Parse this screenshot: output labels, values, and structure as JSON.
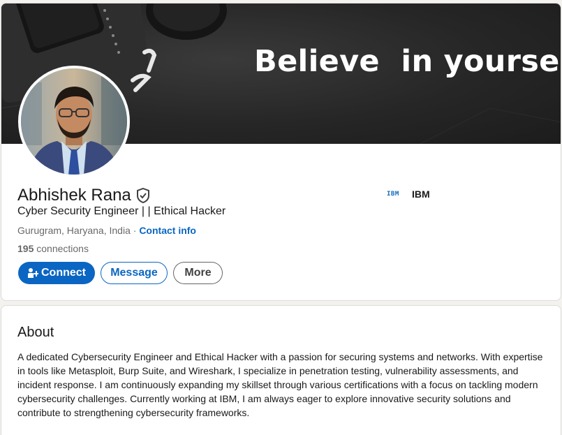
{
  "banner": {
    "text": "Believe  in yourself"
  },
  "profile": {
    "name": "Abhishek Rana",
    "headline": "Cyber Security Engineer | | Ethical Hacker",
    "location": "Gurugram, Haryana, India",
    "separator": " · ",
    "contact_label": "Contact info",
    "connections_count": "195",
    "connections_label": " connections"
  },
  "company": {
    "logo_text": "IBM",
    "name": "IBM"
  },
  "actions": {
    "connect_label": "Connect",
    "message_label": "Message",
    "more_label": "More"
  },
  "about": {
    "title": "About",
    "text": "A dedicated Cybersecurity Engineer and Ethical Hacker with a passion for securing systems and networks. With expertise in tools like Metasploit, Burp Suite, and Wireshark, I specialize in penetration testing, vulnerability assessments, and incident response. I am continuously expanding my skillset through various certifications with a focus on tackling modern cybersecurity challenges. Currently working at IBM, I am always eager to explore innovative security solutions and contribute to strengthening cybersecurity frameworks."
  },
  "colors": {
    "accent": "#0a66c2",
    "background": "#f4f2ee",
    "card": "#ffffff"
  },
  "icons": {
    "verified": "shield-check-icon",
    "connect": "add-person-icon",
    "company": "ibm-logo"
  }
}
